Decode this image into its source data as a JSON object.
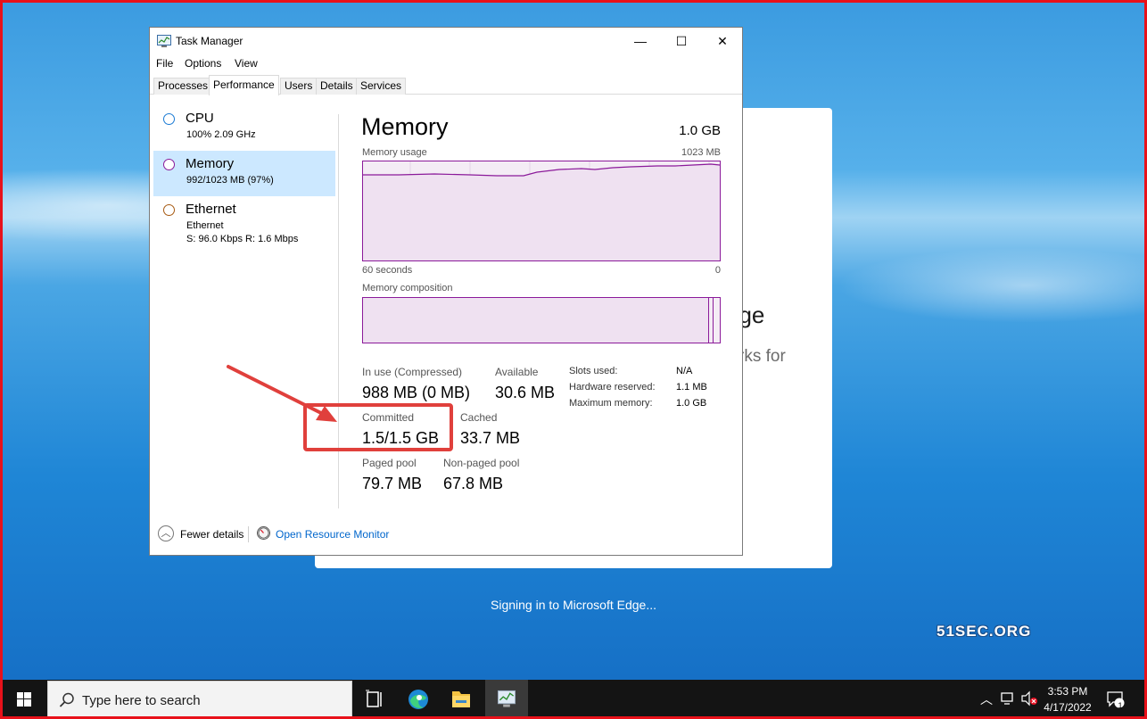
{
  "window": {
    "title": "Task Manager",
    "minimize": "—",
    "maximize": "☐",
    "close": "✕"
  },
  "menu": [
    "File",
    "Options",
    "View"
  ],
  "tabs": [
    "Processes",
    "Performance",
    "Users",
    "Details",
    "Services"
  ],
  "active_tab": "Performance",
  "sidebar": {
    "items": [
      {
        "title": "CPU",
        "sub1": "100%  2.09 GHz",
        "sub2": "",
        "color": "#1a7ad4"
      },
      {
        "title": "Memory",
        "sub1": "992/1023 MB (97%)",
        "sub2": "",
        "color": "#8b1a9a"
      },
      {
        "title": "Ethernet",
        "sub1": "Ethernet",
        "sub2": "S: 96.0 Kbps  R: 1.6 Mbps",
        "color": "#a75a12"
      }
    ],
    "selected": "Memory"
  },
  "memory": {
    "heading": "Memory",
    "total": "1.0 GB",
    "usage_label": "Memory usage",
    "usage_max": "1023 MB",
    "time_left": "60 seconds",
    "time_right": "0",
    "composition_label": "Memory composition",
    "usage_fraction": 0.97
  },
  "stats": {
    "in_use_label": "In use (Compressed)",
    "in_use_value": "988 MB (0 MB)",
    "available_label": "Available",
    "available_value": "30.6 MB",
    "committed_label": "Committed",
    "committed_value": "1.5/1.5 GB",
    "cached_label": "Cached",
    "cached_value": "33.7 MB",
    "paged_label": "Paged pool",
    "paged_value": "79.7 MB",
    "nonpaged_label": "Non-paged pool",
    "nonpaged_value": "67.8 MB",
    "slots_label": "Slots used:",
    "slots_value": "N/A",
    "hw_reserved_label": "Hardware reserved:",
    "hw_reserved_value": "1.1 MB",
    "max_memory_label": "Maximum memory:",
    "max_memory_value": "1.0 GB"
  },
  "footer": {
    "fewer_details": "Fewer details",
    "open_resource_monitor": "Open Resource Monitor"
  },
  "background": {
    "edge_title_fragment": "dge",
    "edge_sub_fragment": "rks for",
    "signing_text": "Signing in to Microsoft Edge...",
    "watermark": "51SEC.ORG"
  },
  "taskbar": {
    "search_placeholder": "Type here to search",
    "time": "3:53 PM",
    "date": "4/17/2022",
    "notification_count": "1"
  }
}
